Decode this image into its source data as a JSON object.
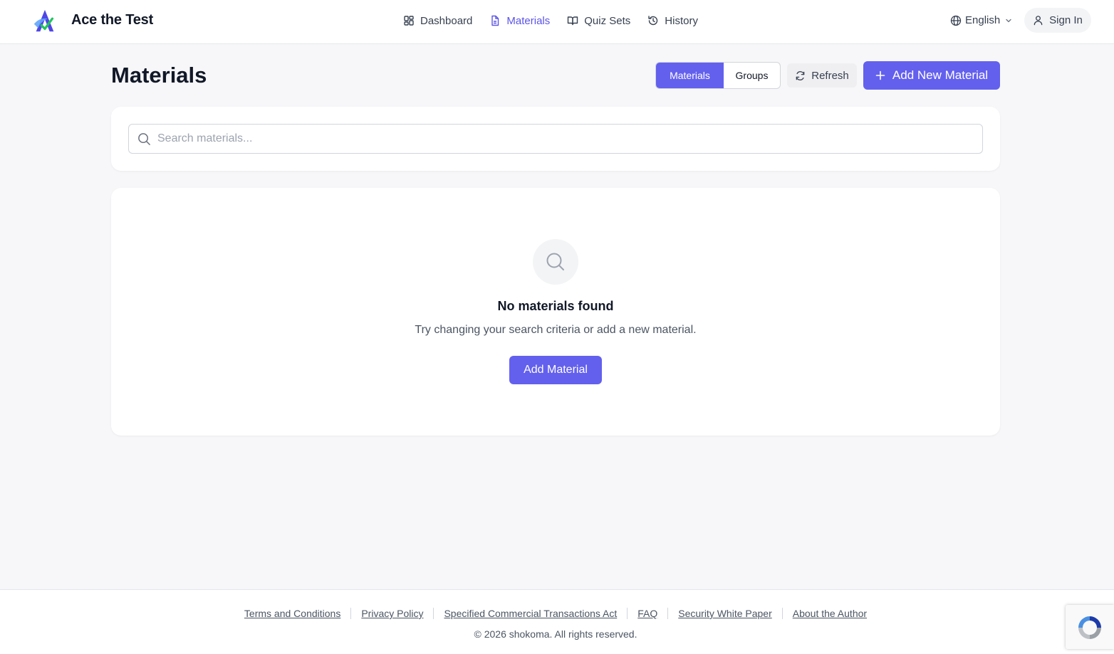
{
  "header": {
    "app_title": "Ace the Test",
    "logo_icon": "ace-logo",
    "nav": [
      {
        "label": "Dashboard",
        "icon": "dashboard-icon",
        "active": false
      },
      {
        "label": "Materials",
        "icon": "document-icon",
        "active": true
      },
      {
        "label": "Quiz Sets",
        "icon": "book-icon",
        "active": false
      },
      {
        "label": "History",
        "icon": "history-icon",
        "active": false
      }
    ],
    "language": "English",
    "sign_in": "Sign In"
  },
  "page": {
    "title": "Materials",
    "segmented": {
      "materials": "Materials",
      "groups": "Groups",
      "selected": "Materials"
    },
    "refresh_label": "Refresh",
    "add_new_label": "Add New Material"
  },
  "search": {
    "placeholder": "Search materials...",
    "value": ""
  },
  "empty_state": {
    "title": "No materials found",
    "subtitle": "Try changing your search criteria or add a new material.",
    "button": "Add Material"
  },
  "footer": {
    "links": [
      "Terms and Conditions",
      "Privacy Policy",
      "Specified Commercial Transactions Act",
      "FAQ",
      "Security White Paper",
      "About the Author"
    ],
    "copyright": "© 2026 shokoma. All rights reserved."
  },
  "colors": {
    "accent": "#6360ee",
    "background": "#f7f7f9"
  }
}
